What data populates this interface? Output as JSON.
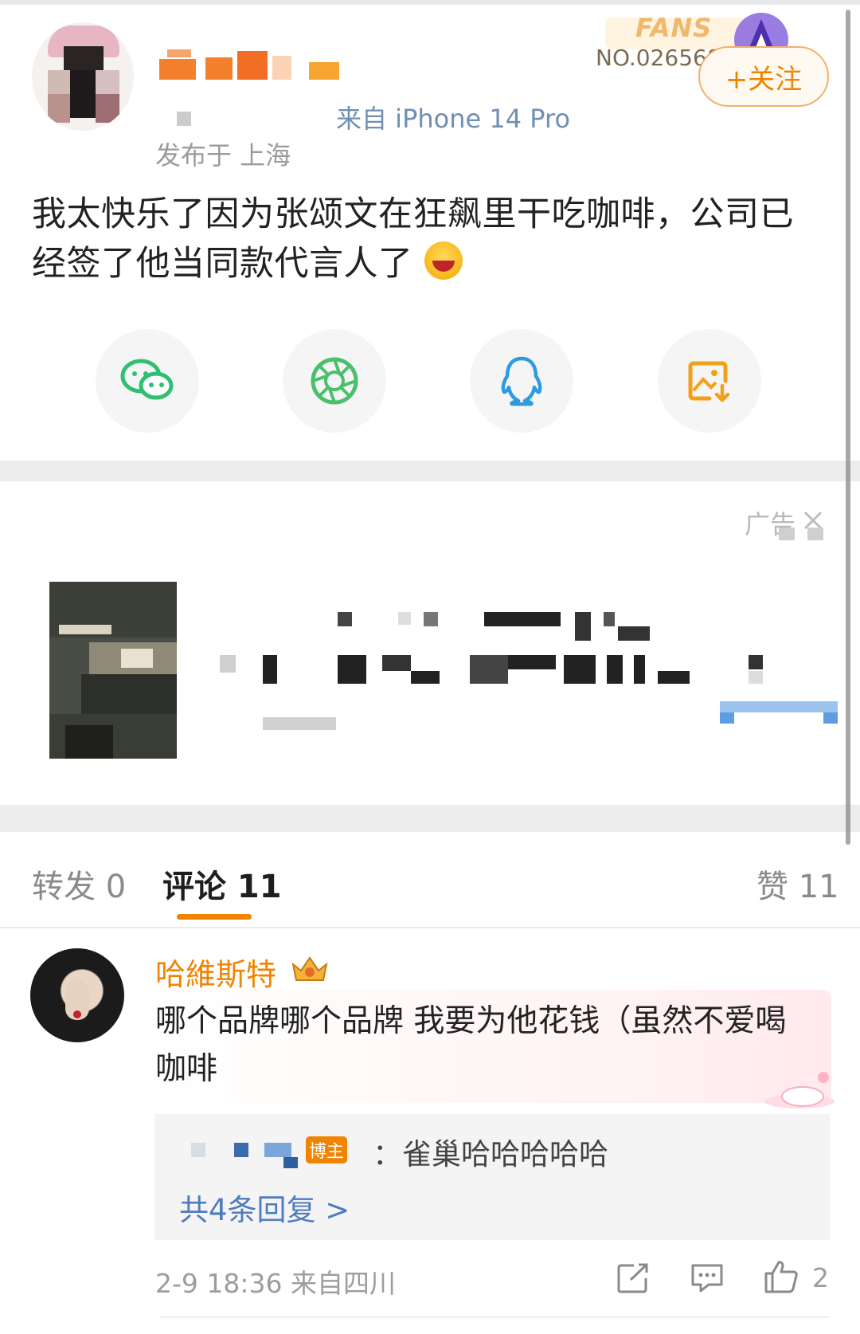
{
  "post": {
    "fans_badge_label": "FANS",
    "fans_number": "NO.026568",
    "follow_label": "+关注",
    "source_text": "来自 iPhone 14 Pro",
    "location_text": "发布于 上海",
    "body_text": "我太快乐了因为张颂文在狂飙里干吃咖啡，公司已经签了他当同款代言人了"
  },
  "share": {
    "icons": [
      "wechat-icon",
      "moments-icon",
      "qq-icon",
      "save-image-icon"
    ]
  },
  "ad": {
    "label": "广告"
  },
  "tabs": {
    "repost": "转发 0",
    "comments": "评论 11",
    "likes": "赞 11"
  },
  "comment": {
    "author": "哈維斯特",
    "text": "哪个品牌哪个品牌 我要为他花钱（虽然不爱喝咖啡",
    "reply_badge": "博主",
    "reply_text": "：雀巢哈哈哈哈哈",
    "replies_link": "共4条回复 >",
    "meta": "2-9 18:36 来自四川",
    "like_count": "2"
  },
  "colors": {
    "accent": "#f08300",
    "link": "#4f7bbf",
    "muted": "#9d9d9d"
  }
}
